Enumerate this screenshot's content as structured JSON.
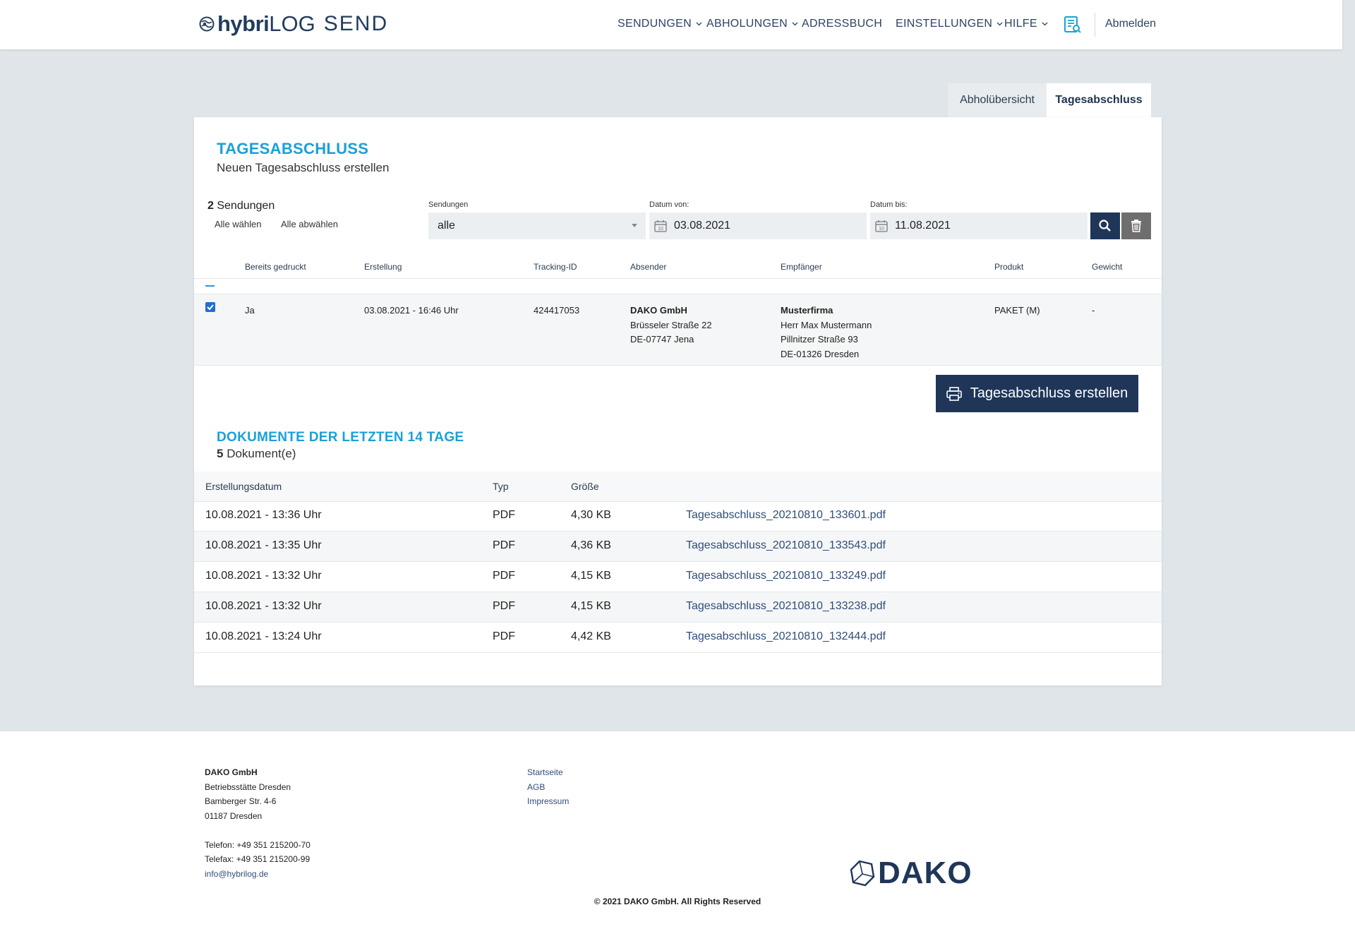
{
  "header": {
    "logo_hybri": "hybri",
    "logo_log": "LOG",
    "logo_send": "SEND",
    "nav": [
      {
        "label": "SENDUNGEN",
        "dropdown": true
      },
      {
        "label": "ABHOLUNGEN",
        "dropdown": true
      },
      {
        "label": "ADRESSBUCH",
        "dropdown": false
      },
      {
        "label": "EINSTELLUNGEN",
        "dropdown": true
      },
      {
        "label": "HILFE",
        "dropdown": true
      }
    ],
    "search_icon": "document-search-icon",
    "logout": "Abmelden"
  },
  "tabs": [
    {
      "label": "Abholübersicht",
      "active": false
    },
    {
      "label": "Tagesabschluss",
      "active": true
    }
  ],
  "section1": {
    "title": "TAGESABSCHLUSS",
    "subtitle": "Neuen Tagesabschluss erstellen",
    "count_value": "2",
    "count_label": "Sendungen",
    "select_all": "Alle wählen",
    "deselect_all": "Alle abwählen"
  },
  "filters": {
    "sendungen_label": "Sendungen",
    "sendungen_value": "alle",
    "date_from_label": "Datum von:",
    "date_from_value": "03.08.2021",
    "date_to_label": "Datum bis:",
    "date_to_value": "11.08.2021",
    "calendar_day": "10"
  },
  "shipments": {
    "headers": [
      "Bereits gedruckt",
      "Erstellung",
      "Tracking-ID",
      "Absender",
      "Empfänger",
      "Produkt",
      "Gewicht"
    ],
    "rows": [
      {
        "checked": true,
        "printed": "Ja",
        "created": "03.08.2021 - 16:46 Uhr",
        "tracking": "424417053",
        "sender": [
          "DAKO GmbH",
          "Brüsseler Straße 22",
          "DE-07747 Jena"
        ],
        "recipient": [
          "Musterfirma",
          "Herr Max Mustermann",
          "Pillnitzer Straße 93",
          "DE-01326 Dresden"
        ],
        "product": "PAKET (M)",
        "weight": "-"
      }
    ]
  },
  "create_button": "Tagesabschluss erstellen",
  "section2": {
    "title": "DOKUMENTE DER LETZTEN 14 TAGE",
    "count_value": "5",
    "count_label": "Dokument(e)"
  },
  "documents": {
    "headers": [
      "Erstellungsdatum",
      "Typ",
      "Größe"
    ],
    "rows": [
      {
        "date": "10.08.2021 - 13:36 Uhr",
        "type": "PDF",
        "size": "4,30 KB",
        "file": "Tagesabschluss_20210810_133601.pdf"
      },
      {
        "date": "10.08.2021 - 13:35 Uhr",
        "type": "PDF",
        "size": "4,36 KB",
        "file": "Tagesabschluss_20210810_133543.pdf"
      },
      {
        "date": "10.08.2021 - 13:32 Uhr",
        "type": "PDF",
        "size": "4,15 KB",
        "file": "Tagesabschluss_20210810_133249.pdf"
      },
      {
        "date": "10.08.2021 - 13:32 Uhr",
        "type": "PDF",
        "size": "4,15 KB",
        "file": "Tagesabschluss_20210810_133238.pdf"
      },
      {
        "date": "10.08.2021 - 13:24 Uhr",
        "type": "PDF",
        "size": "4,42 KB",
        "file": "Tagesabschluss_20210810_132444.pdf"
      }
    ]
  },
  "footer": {
    "company": "DAKO GmbH",
    "address": [
      "Betriebsstätte Dresden",
      "Bamberger Str. 4-6",
      "01187 Dresden"
    ],
    "phone": "Telefon: +49 351 215200-70",
    "fax": "Telefax: +49 351 215200-99",
    "email": "info@hybrilog.de",
    "links": [
      "Startseite",
      "AGB",
      "Impressum"
    ],
    "brand": "DAKO",
    "copyright": "© 2021 DAKO GmbH. All Rights Reserved"
  },
  "colors": {
    "accent": "#1aa0d8",
    "primary": "#1f3659",
    "background": "#dfe5e9"
  }
}
